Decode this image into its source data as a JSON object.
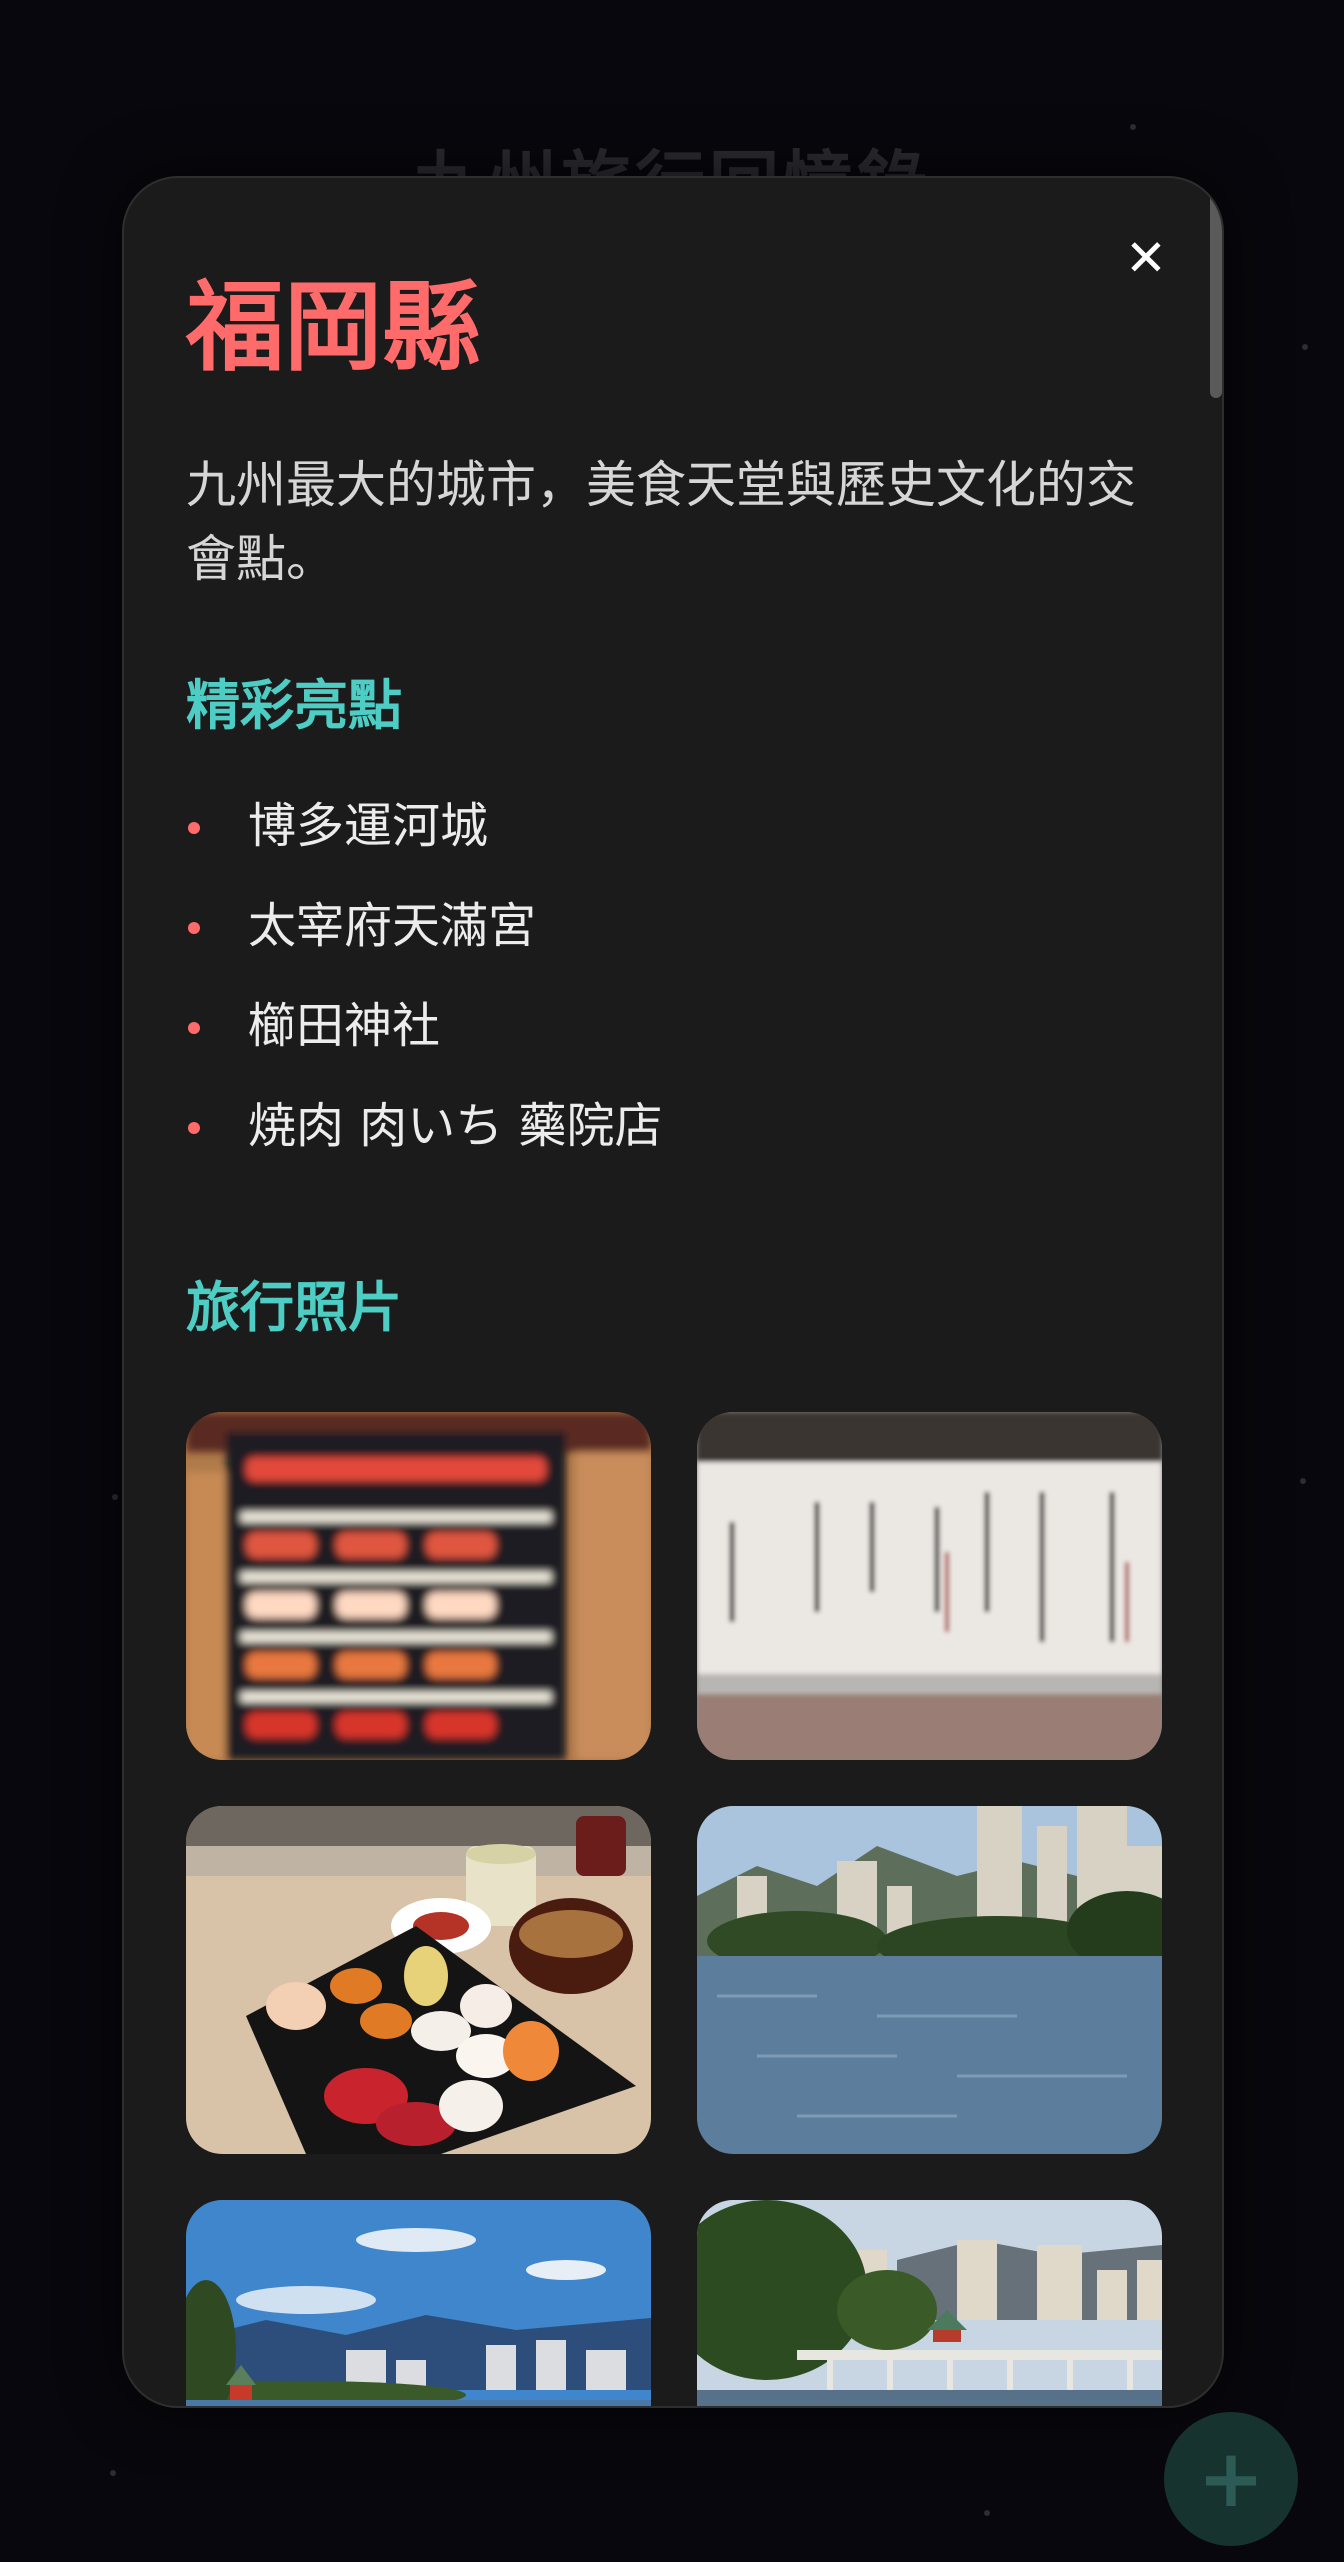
{
  "page": {
    "background_title": "九州旅行回憶錄",
    "fab_label": "+"
  },
  "modal": {
    "close_label": "✕",
    "title": "福岡縣",
    "description": "九州最大的城市，美食天堂與歷史文化的交會點。",
    "highlights_heading": "精彩亮點",
    "highlights": [
      "博多運河城",
      "太宰府天滿宮",
      "櫛田神社",
      "焼肉 肉いち 藥院店"
    ],
    "photos_heading": "旅行照片",
    "photos": [
      {
        "subject": "sushi menu board"
      },
      {
        "subject": "sake menu"
      },
      {
        "subject": "sushi platter"
      },
      {
        "subject": "lake and city skyline"
      },
      {
        "subject": "lake with pavilion"
      },
      {
        "subject": "bridge over lake"
      }
    ]
  },
  "colors": {
    "accent_red": "#ff6b6b",
    "accent_teal": "#4ecdc4",
    "modal_bg": "#1b1b1b",
    "page_bg": "#07070d"
  },
  "icons": {
    "close": "close-icon",
    "add": "plus-icon"
  }
}
